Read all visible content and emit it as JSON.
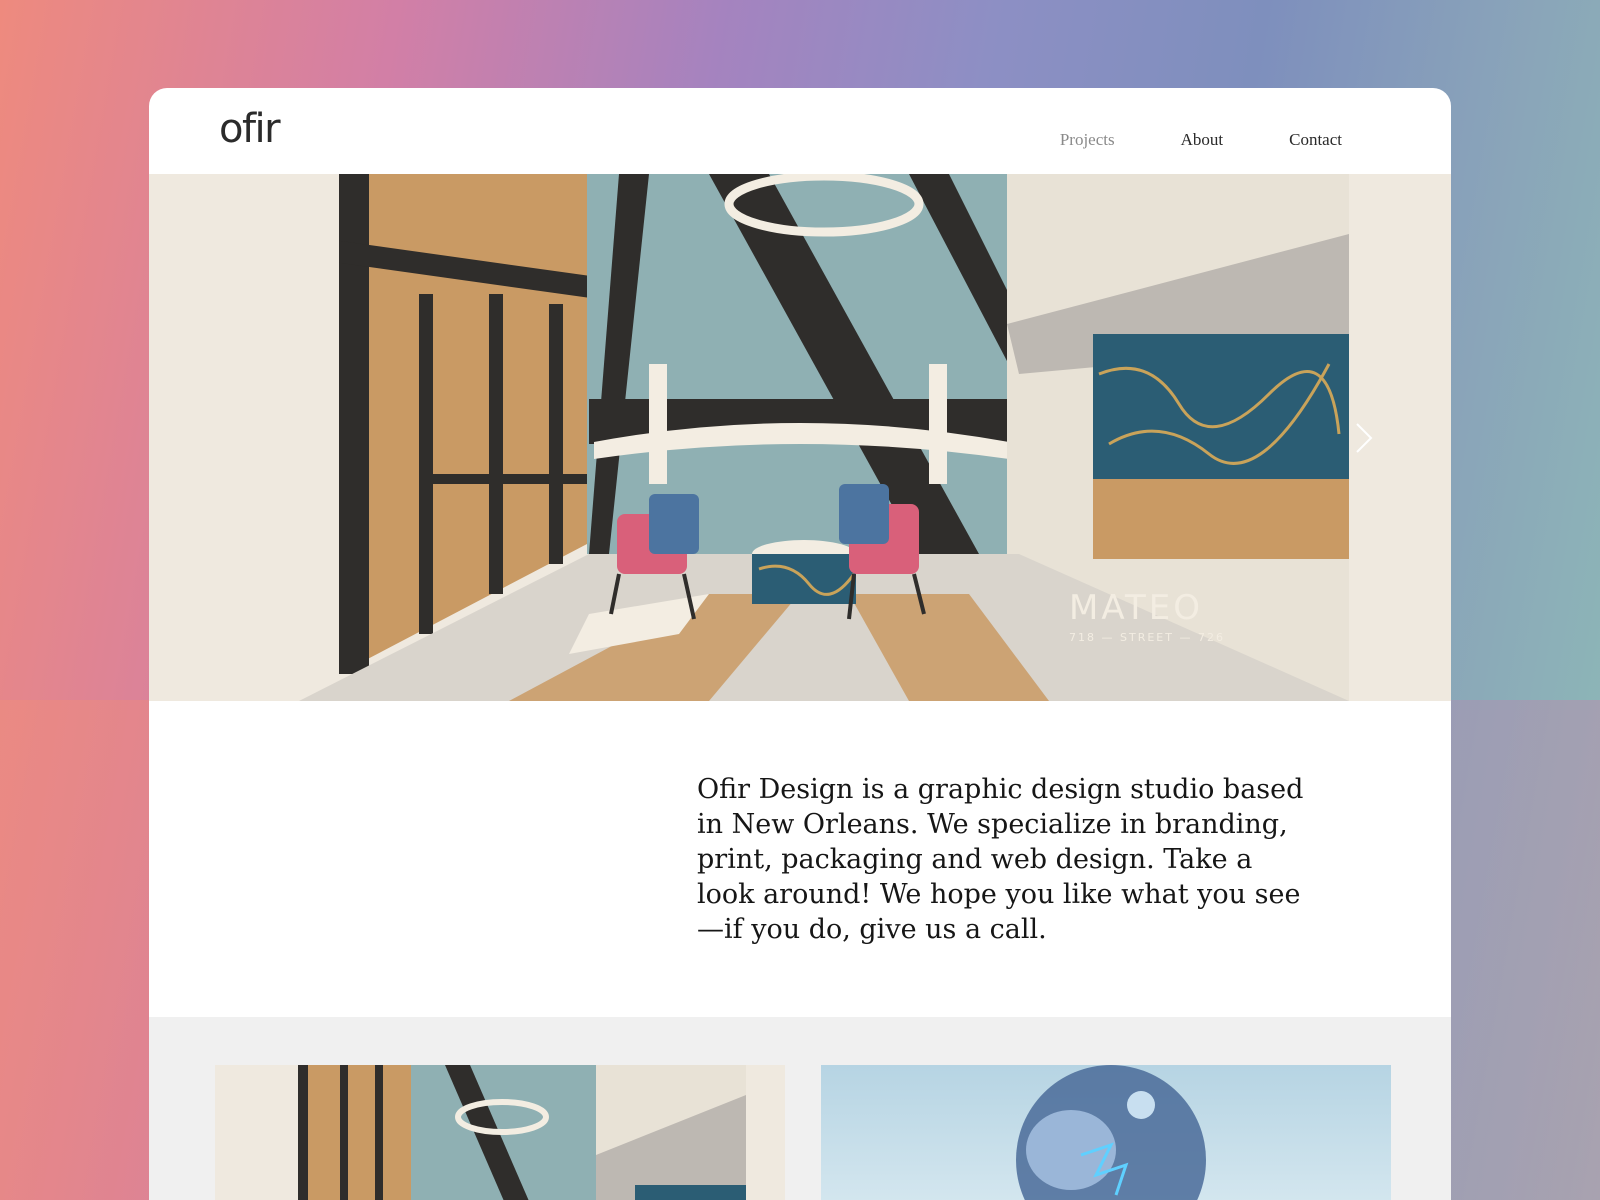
{
  "brand": {
    "logo": "ofir"
  },
  "nav": {
    "links": [
      "Projects",
      "About",
      "Contact"
    ],
    "active": "Projects"
  },
  "hero": {
    "project_title": "MATEO",
    "project_subtitle": "718 — STREET — 726",
    "next_icon": "chevron-right-icon"
  },
  "intro": {
    "text": "Ofir Design is a graphic design studio based in New Orleans. We specialize in branding, print, packaging and web design. Take a look around! We hope you like what you see—if you do, give us a call."
  },
  "colors": {
    "accent_teal": "#8fb0b3",
    "accent_tan": "#c99a64",
    "accent_pink": "#d9607a",
    "dark": "#2f2d2b"
  }
}
